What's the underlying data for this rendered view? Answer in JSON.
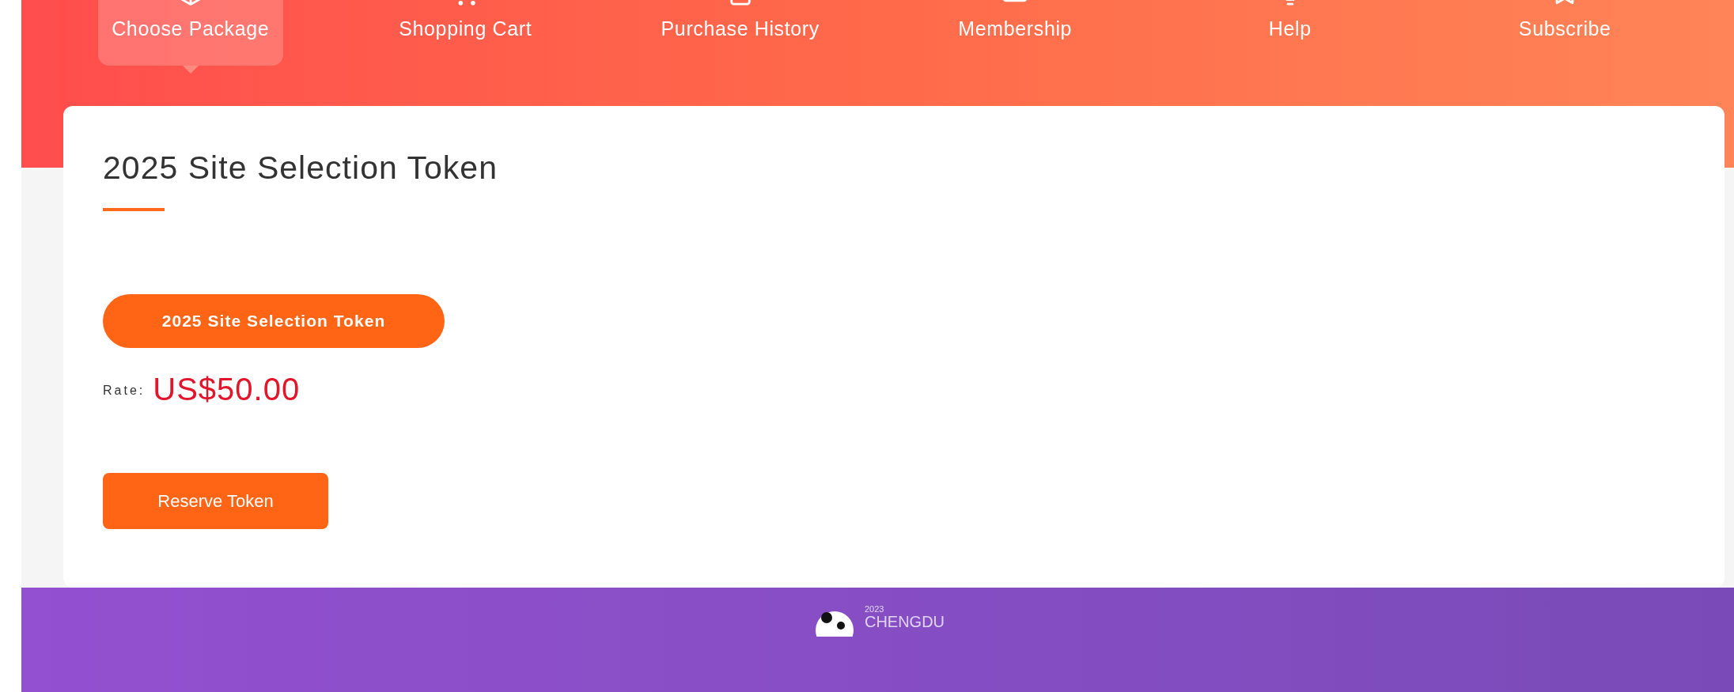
{
  "nav": [
    {
      "label": "Choose Package",
      "selected": true
    },
    {
      "label": "Shopping Cart",
      "selected": false
    },
    {
      "label": "Purchase History",
      "selected": false
    },
    {
      "label": "Membership",
      "selected": false
    },
    {
      "label": "Help",
      "selected": false
    },
    {
      "label": "Subscribe",
      "selected": false
    }
  ],
  "card": {
    "title": "2025 Site Selection Token",
    "package_button": "2025 Site Selection Token",
    "rate_label": "Rate:",
    "rate_value": "US$50.00",
    "action_button": "Reserve Token"
  },
  "footer": {
    "logo_year": "2023",
    "logo_city": "CHENGDU"
  }
}
